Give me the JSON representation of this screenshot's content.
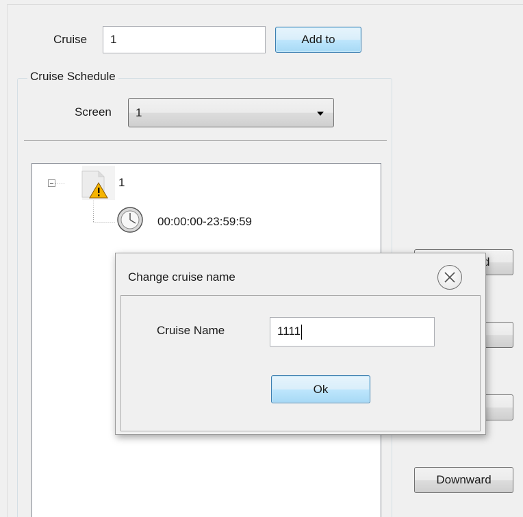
{
  "cruise_form": {
    "cruise_label": "Cruise",
    "cruise_value": "1",
    "add_button": "Add to"
  },
  "schedule": {
    "group_title": "Cruise Schedule",
    "screen_label": "Screen",
    "screen_selected": "1"
  },
  "tree": {
    "root_label": "1",
    "child_label": "00:00:00-23:59:59"
  },
  "side_buttons": {
    "partial_label": "d",
    "downward": "Downward"
  },
  "dialog": {
    "title": "Change cruise name",
    "name_label": "Cruise Name",
    "name_value": "1111",
    "ok_button": "Ok"
  },
  "icons": {
    "close": "close-circle-icon",
    "warning": "warning-icon",
    "clock": "clock-icon",
    "collapse": "tree-collapse-icon",
    "document": "document-icon",
    "dropdown": "chevron-down-icon"
  },
  "colors": {
    "focus_button": "#bee6fd",
    "warning": "#f5b400"
  }
}
